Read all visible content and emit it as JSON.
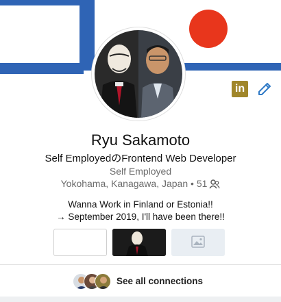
{
  "profile": {
    "name": "Ryu Sakamoto",
    "headline": "Self EmployedのFrontend Web Developer",
    "company": "Self Employed",
    "location": "Yokohama, Kanagawa, Japan",
    "separator": "•",
    "connections_count": "51",
    "summary_line1": "Wanna Work in Finland or Estonia!!",
    "summary_line2": "→ September 2019, I'll have been there!!"
  },
  "actions": {
    "linkedin_label": "in"
  },
  "connections": {
    "see_all_label": "See all connections"
  },
  "colors": {
    "banner_blue": "#2f64b5",
    "banner_sun": "#e8361c",
    "linkedin_gold": "#a0862a",
    "edit_blue": "#2e79c6"
  },
  "icons": [
    "linkedin-icon",
    "edit-pencil-icon",
    "connections-icon",
    "image-placeholder-icon"
  ]
}
